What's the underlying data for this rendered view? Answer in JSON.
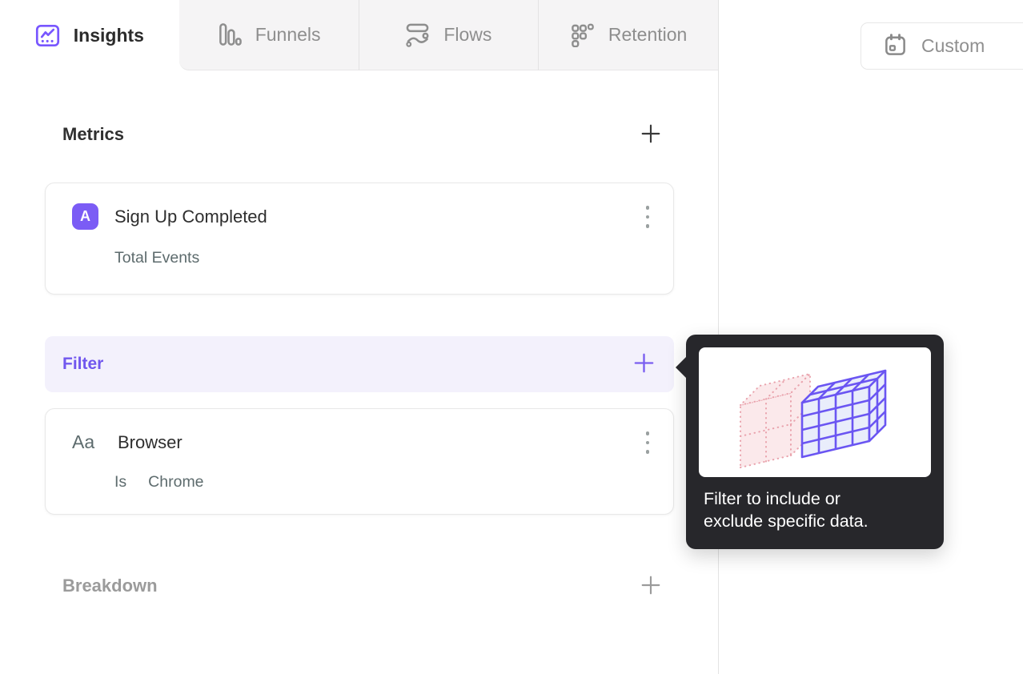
{
  "tabs": {
    "items": [
      {
        "label": "Insights",
        "icon": "line-chart-icon",
        "active": true
      },
      {
        "label": "Funnels",
        "icon": "funnel-bars-icon",
        "active": false
      },
      {
        "label": "Flows",
        "icon": "flow-stream-icon",
        "active": false
      },
      {
        "label": "Retention",
        "icon": "dot-grid-icon",
        "active": false
      }
    ]
  },
  "toolbar": {
    "date_range_label": "Custom",
    "date_range_icon": "calendar-icon"
  },
  "builder": {
    "metrics": {
      "heading": "Metrics",
      "add_icon": "plus-icon"
    },
    "metric_card": {
      "badge_label": "A",
      "title": "Sign Up Completed",
      "subtitle": "Total Events",
      "menu_icon": "kebab-menu-icon"
    },
    "filter": {
      "heading": "Filter",
      "add_icon": "plus-icon"
    },
    "filter_card": {
      "badge_label": "Aa",
      "title": "Browser",
      "operator": "Is",
      "value": "Chrome",
      "menu_icon": "kebab-menu-icon"
    },
    "breakdown": {
      "heading": "Breakdown",
      "add_icon": "plus-icon"
    }
  },
  "tooltip": {
    "text_line1": "Filter to include or",
    "text_line2": "exclude specific data.",
    "illustration": "filter-cube-illustration"
  },
  "colors": {
    "accent_purple": "#7856FF",
    "badge_bg": "#7B5CF5",
    "filter_row_bg": "#F3F1FC",
    "filter_text": "#7157EE",
    "tooltip_bg": "#27272B",
    "inactive_tab_bg": "#F5F4F5",
    "muted_text": "#8E8E8E",
    "secondary_text": "#5D6B6D",
    "card_border": "#E8E8E8",
    "illustration_pink": "#E9A2AC",
    "illustration_purple": "#6A55F2"
  }
}
